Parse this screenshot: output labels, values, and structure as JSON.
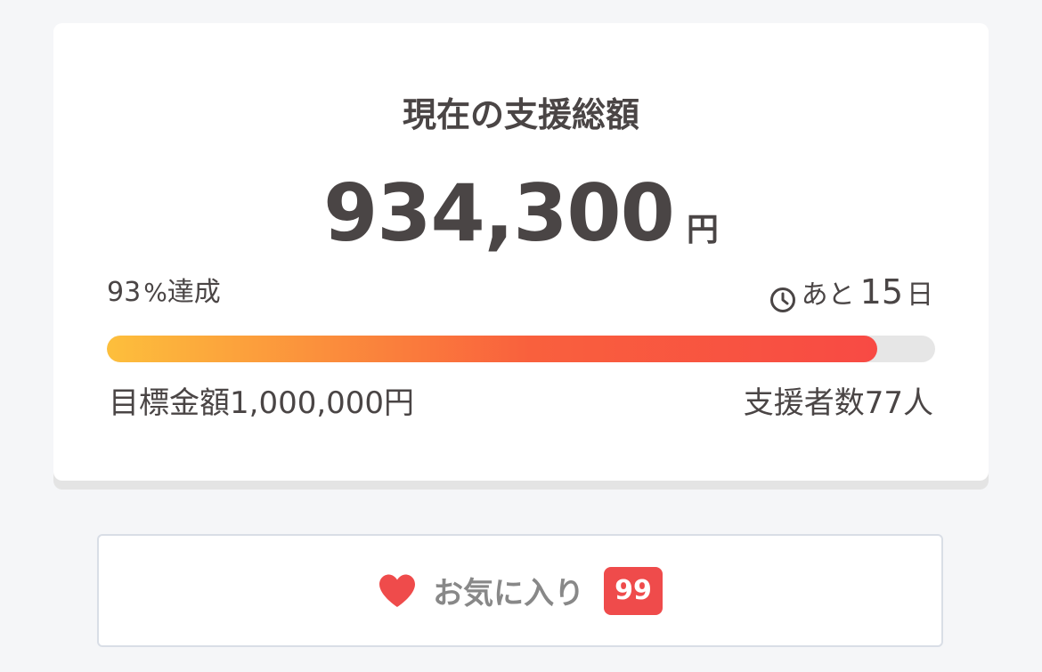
{
  "funding": {
    "title": "現在の支援総額",
    "amount": "934,300",
    "currency": "円",
    "achievement_number": "93",
    "achievement_sign": "%",
    "achievement_suffix": "達成",
    "achievement_percent": 93,
    "remaining_prefix": "あと",
    "remaining_days": "15",
    "remaining_suffix": "日",
    "goal_text": "目標金額1,000,000円",
    "supporters_text": "支援者数77人",
    "progress_colors": [
      "#fdbf3c",
      "#f84a44"
    ]
  },
  "favorite": {
    "label": "お気に入り",
    "count": "99",
    "heart_color": "#ef4b4b",
    "icon": "heart-icon"
  }
}
